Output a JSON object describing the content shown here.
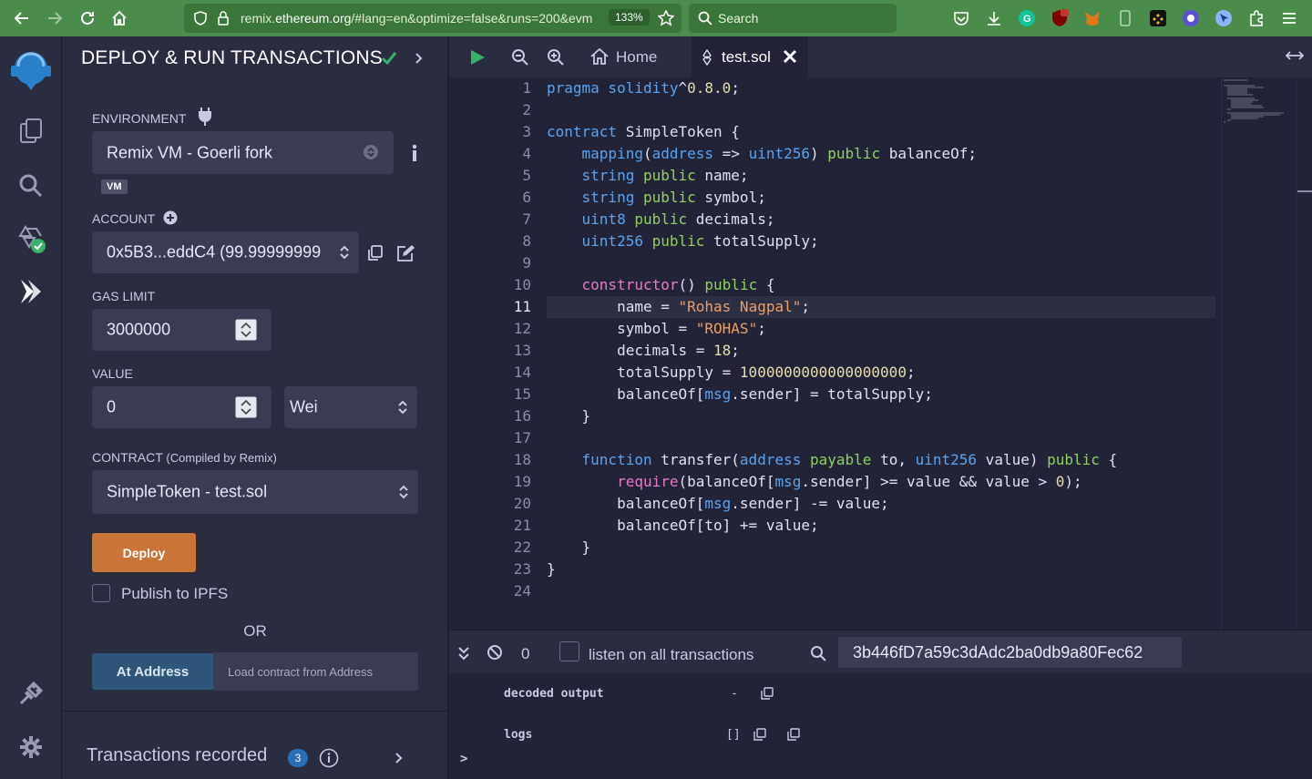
{
  "browser": {
    "url_prefix": "remix.",
    "url_host": "ethereum.org",
    "url_rest": "/#lang=en&optimize=false&runs=200&evm",
    "zoom": "133%",
    "search_placeholder": "Search"
  },
  "panel": {
    "title": "DEPLOY & RUN TRANSACTIONS",
    "environment_label": "ENVIRONMENT",
    "environment_value": "Remix VM - Goerli fork",
    "vm_badge": "VM",
    "account_label": "ACCOUNT",
    "account_value": "0x5B3...eddC4 (99.99999999",
    "gas_limit_label": "GAS LIMIT",
    "gas_limit_value": "3000000",
    "value_label": "VALUE",
    "value_amount": "0",
    "value_unit": "Wei",
    "contract_label": "CONTRACT",
    "contract_sub": "(Compiled by Remix)",
    "contract_value": "SimpleToken - test.sol",
    "deploy_label": "Deploy",
    "publish_label": "Publish to IPFS",
    "or_label": "OR",
    "at_address_label": "At Address",
    "at_address_placeholder": "Load contract from Address",
    "transactions_label": "Transactions recorded",
    "transactions_count": "3"
  },
  "editor": {
    "tab_home": "Home",
    "tab_file": "test.sol",
    "lines": [
      [
        [
          "kw",
          "pragma solidity"
        ],
        [
          "",
          "^"
        ],
        [
          "nm",
          "0.8.0"
        ],
        [
          "",
          ";"
        ]
      ],
      [],
      [
        [
          "kw",
          "contract"
        ],
        [
          "",
          " SimpleToken {"
        ]
      ],
      [
        [
          "",
          "    "
        ],
        [
          "ty",
          "mapping"
        ],
        [
          "",
          "("
        ],
        [
          "ty",
          "address"
        ],
        [
          "",
          " => "
        ],
        [
          "ty",
          "uint256"
        ],
        [
          "",
          ") "
        ],
        [
          "pb",
          "public"
        ],
        [
          "",
          " balanceOf;"
        ]
      ],
      [
        [
          "",
          "    "
        ],
        [
          "ty",
          "string"
        ],
        [
          "",
          " "
        ],
        [
          "pb",
          "public"
        ],
        [
          "",
          " name;"
        ]
      ],
      [
        [
          "",
          "    "
        ],
        [
          "ty",
          "string"
        ],
        [
          "",
          " "
        ],
        [
          "pb",
          "public"
        ],
        [
          "",
          " symbol;"
        ]
      ],
      [
        [
          "",
          "    "
        ],
        [
          "ty",
          "uint8"
        ],
        [
          "",
          " "
        ],
        [
          "pb",
          "public"
        ],
        [
          "",
          " decimals;"
        ]
      ],
      [
        [
          "",
          "    "
        ],
        [
          "ty",
          "uint256"
        ],
        [
          "",
          " "
        ],
        [
          "pb",
          "public"
        ],
        [
          "",
          " totalSupply;"
        ]
      ],
      [],
      [
        [
          "",
          "    "
        ],
        [
          "fn",
          "constructor"
        ],
        [
          "",
          "() "
        ],
        [
          "pb",
          "public"
        ],
        [
          "",
          " {"
        ]
      ],
      [
        [
          "",
          "        name = "
        ],
        [
          "st",
          "\"Rohas Nagpal\""
        ],
        [
          "",
          ";"
        ]
      ],
      [
        [
          "",
          "        symbol = "
        ],
        [
          "st",
          "\"ROHAS\""
        ],
        [
          "",
          ";"
        ]
      ],
      [
        [
          "",
          "        decimals = "
        ],
        [
          "nm",
          "18"
        ],
        [
          "",
          ";"
        ]
      ],
      [
        [
          "",
          "        totalSupply = "
        ],
        [
          "nm",
          "1000000000000000000"
        ],
        [
          "",
          ";"
        ]
      ],
      [
        [
          "",
          "        balanceOf["
        ],
        [
          "ty",
          "msg"
        ],
        [
          "",
          ".sender] = totalSupply;"
        ]
      ],
      [
        [
          "",
          "    }"
        ]
      ],
      [],
      [
        [
          "",
          "    "
        ],
        [
          "kw",
          "function"
        ],
        [
          "",
          " transfer("
        ],
        [
          "ty",
          "address"
        ],
        [
          "",
          " "
        ],
        [
          "pb",
          "payable"
        ],
        [
          "",
          " to, "
        ],
        [
          "ty",
          "uint256"
        ],
        [
          "",
          " value) "
        ],
        [
          "pb",
          "public"
        ],
        [
          "",
          " {"
        ]
      ],
      [
        [
          "",
          "        "
        ],
        [
          "fn",
          "require"
        ],
        [
          "",
          "(balanceOf["
        ],
        [
          "ty",
          "msg"
        ],
        [
          "",
          ".sender] >= value && value > "
        ],
        [
          "nm",
          "0"
        ],
        [
          "",
          ");"
        ]
      ],
      [
        [
          "",
          "        balanceOf["
        ],
        [
          "ty",
          "msg"
        ],
        [
          "",
          ".sender] -= value;"
        ]
      ],
      [
        [
          "",
          "        balanceOf[to] += value;"
        ]
      ],
      [
        [
          "",
          "    }"
        ]
      ],
      [
        [
          "",
          "}"
        ]
      ],
      []
    ]
  },
  "terminal": {
    "pending_count": "0",
    "listen_label": "listen on all transactions",
    "search_value": "3b446fD7a59c3dAdc2ba0db9a80Fec62",
    "decoded_label": "decoded output",
    "decoded_value": "-",
    "logs_label": "logs",
    "logs_value": "[]",
    "prompt": ">"
  }
}
